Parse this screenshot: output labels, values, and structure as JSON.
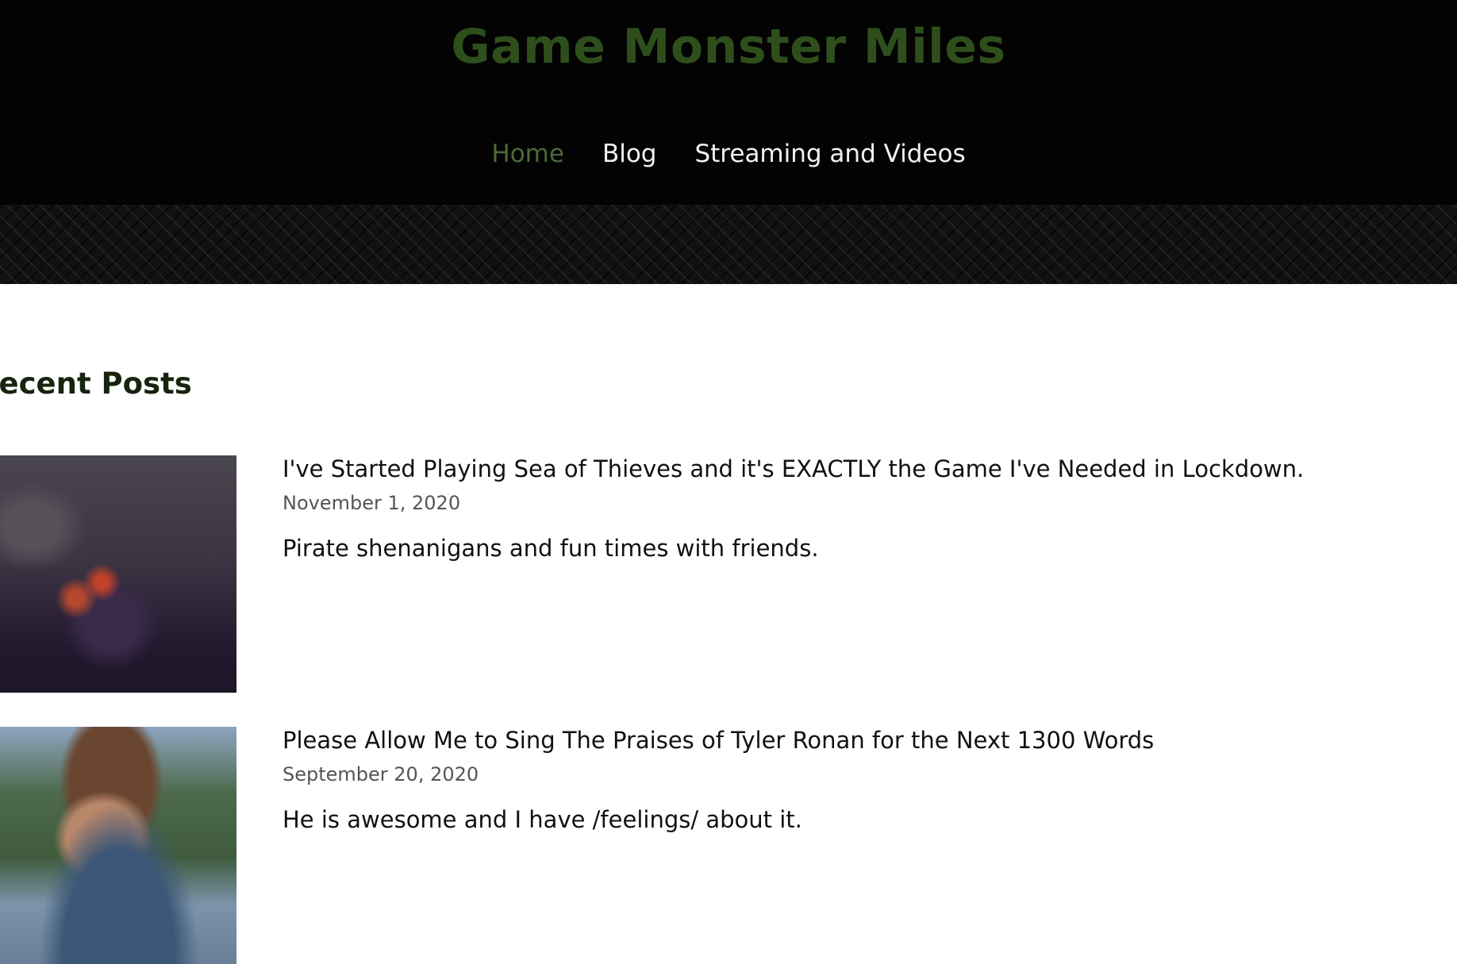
{
  "site": {
    "title": "Game Monster Miles",
    "colors": {
      "title": "#2e4f1c",
      "nav_active": "#4b6b36",
      "header_bg": "#030303"
    }
  },
  "nav": {
    "items": [
      {
        "label": "Home",
        "active": true
      },
      {
        "label": "Blog",
        "active": false
      },
      {
        "label": "Streaming and Videos",
        "active": false
      }
    ]
  },
  "section": {
    "title": "Recent Posts"
  },
  "posts": [
    {
      "title": "I've Started Playing Sea of Thieves and it's EXACTLY the Game I've Needed in Lockdown.",
      "date": "November 1, 2020",
      "excerpt": "Pirate shenanigans and fun times with friends."
    },
    {
      "title": "Please Allow Me to Sing The Praises of Tyler Ronan for the Next 1300 Words",
      "date": "September 20, 2020",
      "excerpt": "He is awesome and I have /feelings/ about it."
    }
  ]
}
